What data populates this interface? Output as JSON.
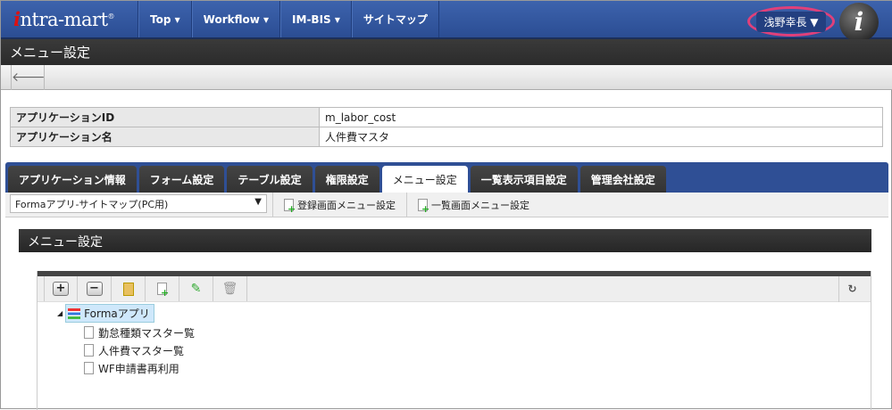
{
  "header": {
    "logo": "intra-mart",
    "nav": [
      "Top ▾",
      "Workflow ▾",
      "IM-BIS ▾",
      "サイトマップ"
    ],
    "user": "浅野幸長 ▼",
    "brand_icon": "i"
  },
  "page_title": "メニュー設定",
  "toolbar": {
    "back_icon": "🡐"
  },
  "info": [
    {
      "label": "アプリケーションID",
      "value": "m_labor_cost"
    },
    {
      "label": "アプリケーション名",
      "value": "人件費マスタ"
    }
  ],
  "tabs": [
    "アプリケーション情報",
    "フォーム設定",
    "テーブル設定",
    "権限設定",
    "メニュー設定",
    "一覧表示項目設定",
    "管理会社設定"
  ],
  "sub": {
    "select": "Formaアプリ-サイトマップ(PC用)",
    "btn1": "登録画面メニュー設定",
    "btn2": "一覧画面メニュー設定"
  },
  "section_title": "メニュー設定",
  "tree": {
    "root": "Formaアプリ",
    "children": [
      "勤怠種類マスター覧",
      "人件費マスター覧",
      "WF申請書再利用"
    ]
  }
}
